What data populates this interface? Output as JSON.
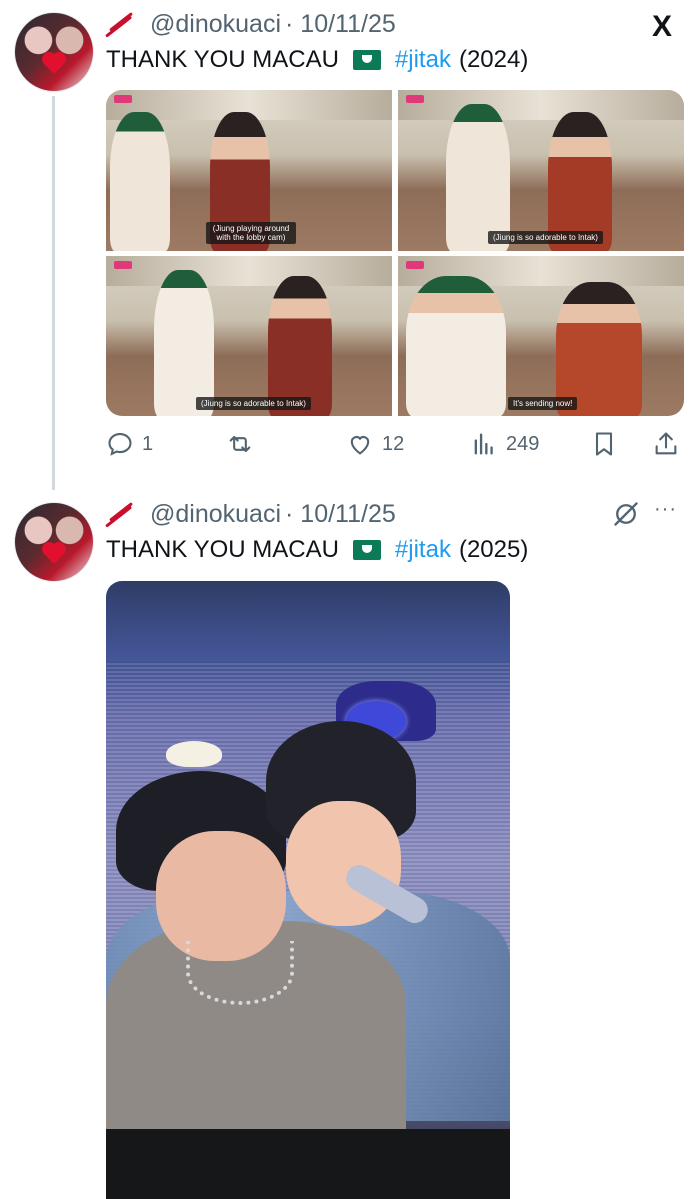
{
  "post1": {
    "handle": "@dinokuaci",
    "date": "· 10/11/25",
    "text_prefix": "THANK YOU MACAU",
    "hashtag": "#jitak",
    "year": "(2024)",
    "captions": [
      "(Jiung playing around with the lobby cam)",
      "(Jiung is so adorable to Intak)",
      "(Jiung is so adorable to Intak)",
      "It's sending now!"
    ],
    "actions": {
      "replies": "1",
      "retweets": "",
      "likes": "12",
      "views": "249"
    }
  },
  "post2": {
    "handle": "@dinokuaci",
    "date": "· 10/11/25",
    "text_prefix": "THANK YOU MACAU",
    "hashtag": "#jitak",
    "year": "(2025)",
    "more": "···"
  },
  "brand": {
    "logo": "X"
  },
  "colors": {
    "accent": "#1d9bf0",
    "muted": "#536471",
    "text": "#0f1419",
    "thread": "#cfd9de"
  }
}
